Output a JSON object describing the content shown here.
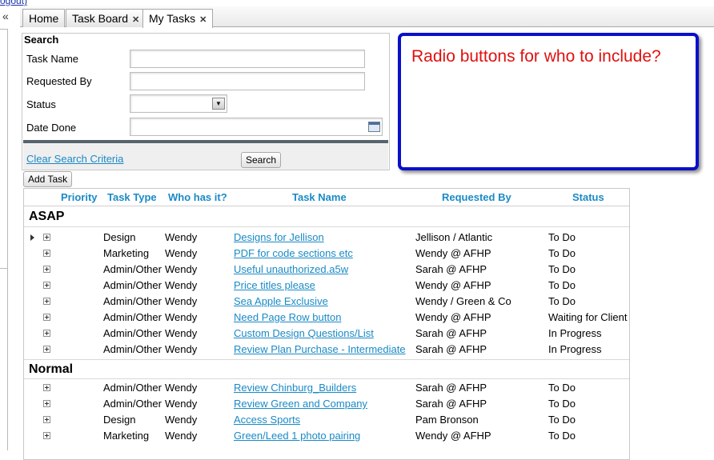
{
  "header": {
    "logout_label": "ogout)"
  },
  "sidebar": {
    "collapse_glyph": "«"
  },
  "tabs": [
    {
      "label": "Home",
      "closable": false,
      "active": false
    },
    {
      "label": "Task Board",
      "closable": true,
      "active": false
    },
    {
      "label": "My Tasks",
      "closable": true,
      "active": true
    }
  ],
  "search": {
    "title": "Search",
    "task_name_label": "Task Name",
    "task_name_value": "",
    "requested_by_label": "Requested By",
    "requested_by_value": "",
    "status_label": "Status",
    "status_value": "",
    "date_done_label": "Date Done",
    "date_done_value": "",
    "clear_label": "Clear Search Criteria",
    "search_button": "Search"
  },
  "annotation": {
    "text": "Radio buttons for who to include?",
    "border_color": "#0a10c8",
    "text_color": "#e01010"
  },
  "toolbar": {
    "add_task_label": "Add Task"
  },
  "grid": {
    "columns": {
      "priority": "Priority",
      "task_type": "Task Type",
      "who": "Who has it?",
      "task_name": "Task Name",
      "requested_by": "Requested By",
      "status": "Status"
    },
    "groups": [
      {
        "name": "ASAP",
        "rows": [
          {
            "type": "Design",
            "who": "Wendy",
            "name": "Designs for Jellison",
            "requested_by": "Jellison / Atlantic",
            "status": "To Do"
          },
          {
            "type": "Marketing",
            "who": "Wendy",
            "name": "PDF for code sections etc",
            "requested_by": "Wendy @ AFHP",
            "status": "To Do"
          },
          {
            "type": "Admin/Other",
            "who": "Wendy",
            "name": "Useful unauthorized.a5w",
            "requested_by": "Sarah @ AFHP",
            "status": "To Do"
          },
          {
            "type": "Admin/Other",
            "who": "Wendy",
            "name": "Price titles please",
            "requested_by": "Wendy @ AFHP",
            "status": "To Do"
          },
          {
            "type": "Admin/Other",
            "who": "Wendy",
            "name": "Sea Apple Exclusive",
            "requested_by": "Wendy / Green & Co",
            "status": "To Do"
          },
          {
            "type": "Admin/Other",
            "who": "Wendy",
            "name": "Need Page Row button",
            "requested_by": "Wendy @ AFHP",
            "status": "Waiting for Client"
          },
          {
            "type": "Admin/Other",
            "who": "Wendy",
            "name": "Custom Design Questions/List",
            "requested_by": "Sarah @ AFHP",
            "status": "In Progress"
          },
          {
            "type": "Admin/Other",
            "who": "Wendy",
            "name": "Review Plan Purchase - Intermediate",
            "requested_by": "Sarah @ AFHP",
            "status": "In Progress"
          }
        ]
      },
      {
        "name": "Normal",
        "rows": [
          {
            "type": "Admin/Other",
            "who": "Wendy",
            "name": "Review Chinburg_Builders",
            "requested_by": "Sarah @ AFHP",
            "status": "To Do"
          },
          {
            "type": "Admin/Other",
            "who": "Wendy",
            "name": "Review Green and Company",
            "requested_by": "Sarah @ AFHP",
            "status": "To Do"
          },
          {
            "type": "Design",
            "who": "Wendy",
            "name": "Access Sports",
            "requested_by": "Pam Bronson",
            "status": "To Do"
          },
          {
            "type": "Marketing",
            "who": "Wendy",
            "name": "Green/Leed 1 photo pairing",
            "requested_by": "Wendy @ AFHP",
            "status": "To Do"
          }
        ]
      }
    ]
  }
}
